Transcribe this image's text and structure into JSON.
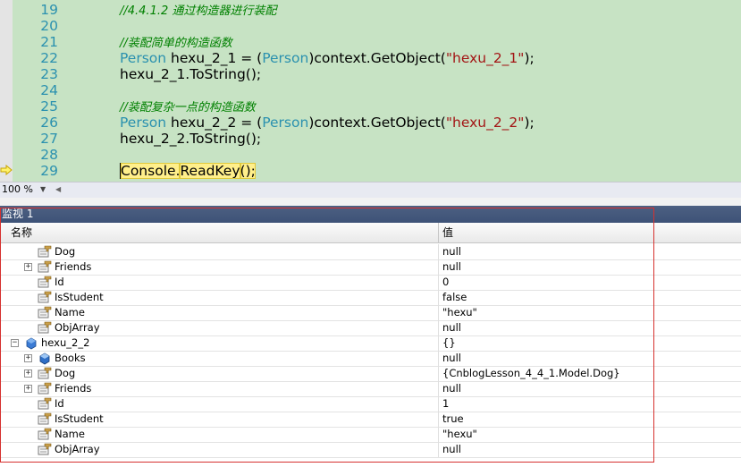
{
  "editor": {
    "lines": [
      {
        "num": "19",
        "parts": [
          {
            "t": "//4.4.1.2 通过构造器进行装配",
            "c": "cmt"
          }
        ]
      },
      {
        "num": "20",
        "parts": []
      },
      {
        "num": "21",
        "parts": [
          {
            "t": "//装配简单的构造函数",
            "c": "cmt"
          }
        ]
      },
      {
        "num": "22",
        "parts": [
          {
            "t": "Person",
            "c": "kw-type"
          },
          {
            "t": " hexu_2_1 = (",
            "c": ""
          },
          {
            "t": "Person",
            "c": "kw-type"
          },
          {
            "t": ")context.GetObject(",
            "c": ""
          },
          {
            "t": "\"hexu_2_1\"",
            "c": "str"
          },
          {
            "t": ");",
            "c": ""
          }
        ]
      },
      {
        "num": "23",
        "parts": [
          {
            "t": "hexu_2_1.ToString();",
            "c": ""
          }
        ]
      },
      {
        "num": "24",
        "parts": []
      },
      {
        "num": "25",
        "parts": [
          {
            "t": "//装配复杂一点的构造函数",
            "c": "cmt"
          }
        ]
      },
      {
        "num": "26",
        "parts": [
          {
            "t": "Person",
            "c": "kw-type"
          },
          {
            "t": " hexu_2_2 = (",
            "c": ""
          },
          {
            "t": "Person",
            "c": "kw-type"
          },
          {
            "t": ")context.GetObject(",
            "c": ""
          },
          {
            "t": "\"hexu_2_2\"",
            "c": "str"
          },
          {
            "t": ");",
            "c": ""
          }
        ]
      },
      {
        "num": "27",
        "parts": [
          {
            "t": "hexu_2_2.ToString();",
            "c": ""
          }
        ]
      },
      {
        "num": "28",
        "parts": []
      },
      {
        "num": "29",
        "parts": [
          {
            "t": "Console.",
            "c": "highlight caret"
          },
          {
            "t": "ReadKey",
            "c": "highlight"
          },
          {
            "t": "();",
            "c": "highlight"
          }
        ]
      }
    ]
  },
  "zoom": {
    "value": "100 %"
  },
  "watch": {
    "title": "监视 1",
    "col_name": "名称",
    "col_value": "值",
    "rows": [
      {
        "name": "Dog",
        "value": "null",
        "indent": 1,
        "expandable": false,
        "icon": "property-icon"
      },
      {
        "name": "Friends",
        "value": "null",
        "indent": 1,
        "expandable": true,
        "icon": "property-icon"
      },
      {
        "name": "Id",
        "value": "0",
        "indent": 1,
        "expandable": false,
        "icon": "property-icon"
      },
      {
        "name": "IsStudent",
        "value": "false",
        "indent": 1,
        "expandable": false,
        "icon": "property-icon"
      },
      {
        "name": "Name",
        "value": "\"hexu\"",
        "indent": 1,
        "expandable": false,
        "icon": "property-icon"
      },
      {
        "name": "ObjArray",
        "value": "null",
        "indent": 1,
        "expandable": false,
        "icon": "property-icon"
      },
      {
        "name": "hexu_2_2",
        "value": "{}",
        "indent": 0,
        "expandable": true,
        "expanded": true,
        "icon": "variable-icon"
      },
      {
        "name": "Books",
        "value": "null",
        "indent": 1,
        "expandable": true,
        "icon": "field-icon"
      },
      {
        "name": "Dog",
        "value": "{CnblogLesson_4_4_1.Model.Dog}",
        "indent": 1,
        "expandable": true,
        "icon": "property-icon"
      },
      {
        "name": "Friends",
        "value": "null",
        "indent": 1,
        "expandable": true,
        "icon": "property-icon"
      },
      {
        "name": "Id",
        "value": "1",
        "indent": 1,
        "expandable": false,
        "icon": "property-icon"
      },
      {
        "name": "IsStudent",
        "value": "true",
        "indent": 1,
        "expandable": false,
        "icon": "property-icon"
      },
      {
        "name": "Name",
        "value": "\"hexu\"",
        "indent": 1,
        "expandable": false,
        "icon": "property-icon"
      },
      {
        "name": "ObjArray",
        "value": "null",
        "indent": 1,
        "expandable": false,
        "icon": "property-icon"
      }
    ]
  },
  "colors": {
    "editor_bg": "#c7e3c4",
    "line_number": "#2b91af",
    "type": "#2b91af",
    "string": "#a31515",
    "comment": "#008000",
    "current_line": "#ffef8b",
    "watch_title_bg": "#3d5277",
    "annotation_frame": "#d6312f"
  }
}
